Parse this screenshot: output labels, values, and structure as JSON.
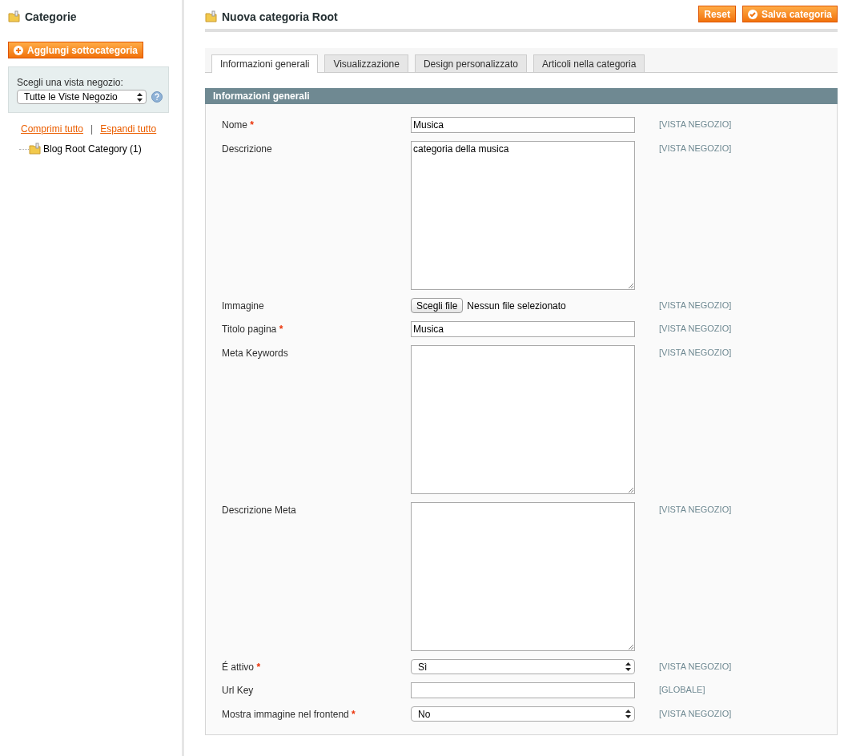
{
  "sidebar": {
    "title": "Categorie",
    "add_button": "Agglungi sottocategoria",
    "store_switcher": {
      "label": "Scegli una vista negozio:",
      "value": "Tutte le Viste Negozio"
    },
    "collapse_link": "Comprimi tutto",
    "separator": "|",
    "expand_link": "Espandi tutto",
    "tree": [
      {
        "label": "Blog Root Category (1)"
      }
    ]
  },
  "header": {
    "title": "Nuova categoria Root",
    "buttons": [
      {
        "label": "Reset",
        "kind": "plain"
      },
      {
        "label": "Salva categoria",
        "kind": "save"
      }
    ]
  },
  "tabs": [
    {
      "label": "Informazioni generali",
      "selected": true
    },
    {
      "label": "Visualizzazione",
      "selected": false
    },
    {
      "label": "Design personalizzato",
      "selected": false
    },
    {
      "label": "Articoli nella categoria",
      "selected": false
    }
  ],
  "section": {
    "title": "Informazioni generali",
    "fields": [
      {
        "label": "Nome",
        "required_mark": "*",
        "kind": "text",
        "value": "Musica",
        "scope": "[VISTA NEGOZIO]"
      },
      {
        "label": "Descrizione",
        "kind": "textarea",
        "value": "categoria della musica",
        "scope": "[VISTA NEGOZIO]"
      },
      {
        "label": "Immagine",
        "kind": "file",
        "button": "Scegli file",
        "value": "Nessun file selezionato",
        "scope": "[VISTA NEGOZIO]"
      },
      {
        "label": "Titolo pagina",
        "required_mark": "*",
        "kind": "text",
        "value": "Musica",
        "scope": "[VISTA NEGOZIO]"
      },
      {
        "label": "Meta Keywords",
        "kind": "textarea",
        "scope": "[VISTA NEGOZIO]"
      },
      {
        "label": "Descrizione Meta",
        "kind": "textarea",
        "scope": "[VISTA NEGOZIO]"
      },
      {
        "label": "É attivo",
        "required_mark": "*",
        "kind": "select",
        "value": "Sì",
        "scope": "[VISTA NEGOZIO]"
      },
      {
        "label": "Url Key",
        "kind": "text",
        "scope": "[GLOBALE]"
      },
      {
        "label": "Mostra immagine nel frontend",
        "required_mark": "*",
        "kind": "select",
        "value": "No",
        "scope": "[VISTA NEGOZIO]"
      }
    ]
  }
}
